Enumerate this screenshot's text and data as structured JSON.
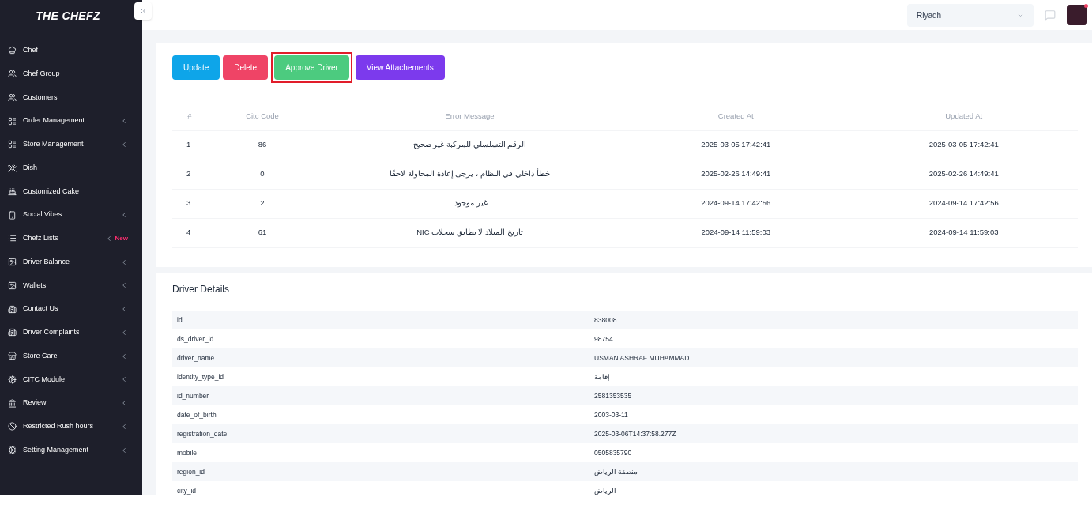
{
  "brand": "THE CHEFZ",
  "sidebar": {
    "items": [
      {
        "label": "Chef",
        "submenu": false
      },
      {
        "label": "Chef Group",
        "submenu": false
      },
      {
        "label": "Customers",
        "submenu": false
      },
      {
        "label": "Order Management",
        "submenu": true
      },
      {
        "label": "Store Management",
        "submenu": true
      },
      {
        "label": "Dish",
        "submenu": false
      },
      {
        "label": "Customized Cake",
        "submenu": false
      },
      {
        "label": "Social Vibes",
        "submenu": true
      },
      {
        "label": "Chefz Lists",
        "submenu": true,
        "badge": "New"
      },
      {
        "label": "Driver Balance",
        "submenu": true
      },
      {
        "label": "Wallets",
        "submenu": true
      },
      {
        "label": "Contact Us",
        "submenu": true
      },
      {
        "label": "Driver Complaints",
        "submenu": true
      },
      {
        "label": "Store Care",
        "submenu": true
      },
      {
        "label": "CITC Module",
        "submenu": true
      },
      {
        "label": "Review",
        "submenu": true
      },
      {
        "label": "Restricted Rush hours",
        "submenu": true
      },
      {
        "label": "Setting Management",
        "submenu": true
      }
    ]
  },
  "topbar": {
    "city": "Riyadh"
  },
  "actions": [
    {
      "label": "Update",
      "kind": "info",
      "highlighted": false
    },
    {
      "label": "Delete",
      "kind": "danger",
      "highlighted": false
    },
    {
      "label": "Approve Driver",
      "kind": "success",
      "highlighted": true
    },
    {
      "label": "View Attachements",
      "kind": "purple",
      "highlighted": false
    }
  ],
  "errors_table": {
    "columns": [
      "#",
      "Citc Code",
      "Error Message",
      "Created At",
      "Updated At"
    ],
    "rows": [
      [
        "1",
        "86",
        "الرقم التسلسلي للمركبة غير صحيح",
        "2025-03-05 17:42:41",
        "2025-03-05 17:42:41"
      ],
      [
        "2",
        "0",
        "خطأ داخلي في النظام ، يرجى إعادة المحاولة لاحقًا",
        "2025-02-26 14:49:41",
        "2025-02-26 14:49:41"
      ],
      [
        "3",
        "2",
        "غير موجود.",
        "2024-09-14 17:42:56",
        "2024-09-14 17:42:56"
      ],
      [
        "4",
        "61",
        "تاريخ الميلاد لا يطابق سجلات NIC",
        "2024-09-14 11:59:03",
        "2024-09-14 11:59:03"
      ]
    ]
  },
  "driver_details": {
    "title": "Driver Details",
    "rows": [
      {
        "key": "id",
        "value": "838008"
      },
      {
        "key": "ds_driver_id",
        "value": "98754"
      },
      {
        "key": "driver_name",
        "value": "USMAN ASHRAF MUHAMMAD"
      },
      {
        "key": "identity_type_id",
        "value": "إقامة"
      },
      {
        "key": "id_number",
        "value": "2581353535"
      },
      {
        "key": "date_of_birth",
        "value": "2003-03-11"
      },
      {
        "key": "registration_date",
        "value": "2025-03-06T14:37:58.277Z"
      },
      {
        "key": "mobile",
        "value": "0505835790"
      },
      {
        "key": "region_id",
        "value": "منطقة الرياض"
      },
      {
        "key": "city_id",
        "value": "الرياض"
      }
    ]
  }
}
